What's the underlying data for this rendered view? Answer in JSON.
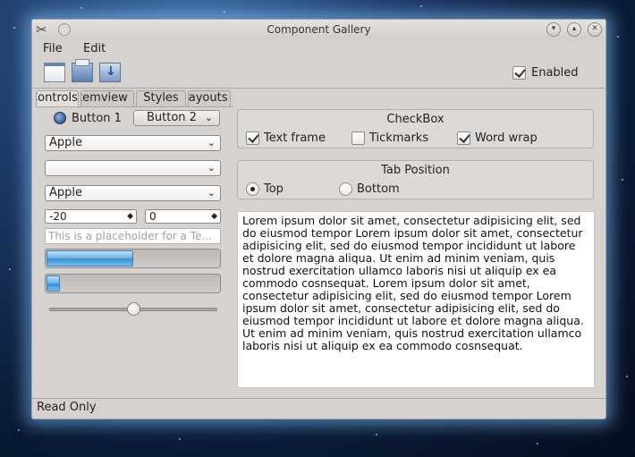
{
  "window": {
    "title": "Component Gallery"
  },
  "menu": [
    "File",
    "Edit"
  ],
  "toolbar": {
    "icons": [
      "new-document-icon",
      "open-folder-icon",
      "save-icon"
    ],
    "enabled_label": "Enabled",
    "enabled_checked": true
  },
  "tabs": [
    "Controls",
    "Itemview",
    "Styles",
    "Layouts"
  ],
  "controls": {
    "button1": "Button 1",
    "button2": "Button 2",
    "combo1": "Apple",
    "combo2": "",
    "combo3": "Apple",
    "spin1": "-20",
    "spin2": "0",
    "placeholder": "This is a placeholder for a Te...",
    "progress1": 0.5,
    "progress2": 0.08,
    "slider": 0.5
  },
  "checkbox_group": {
    "title": "CheckBox",
    "options": [
      {
        "label": "Text frame",
        "checked": true
      },
      {
        "label": "Tickmarks",
        "checked": false
      },
      {
        "label": "Word wrap",
        "checked": true
      }
    ]
  },
  "tab_position_group": {
    "title": "Tab Position",
    "options": [
      {
        "label": "Top",
        "selected": true
      },
      {
        "label": "Bottom",
        "selected": false
      }
    ]
  },
  "text_frame": "Lorem ipsum dolor sit amet, consectetur adipisicing elit, sed do eiusmod tempor Lorem ipsum dolor sit amet, consectetur adipisicing elit, sed do eiusmod tempor incididunt ut labore et dolore magna aliqua. Ut enim ad minim veniam, quis nostrud exercitation ullamco laboris nisi ut aliquip ex ea commodo cosnsequat. Lorem ipsum dolor sit amet, consectetur adipisicing elit, sed do eiusmod tempor Lorem ipsum dolor sit amet, consectetur adipisicing elit, sed do eiusmod tempor incididunt ut labore et dolore magna aliqua. Ut enim ad minim veniam, quis nostrud exercitation ullamco laboris nisi ut aliquip ex ea commodo cosnsequat.",
  "status": "Read Only"
}
